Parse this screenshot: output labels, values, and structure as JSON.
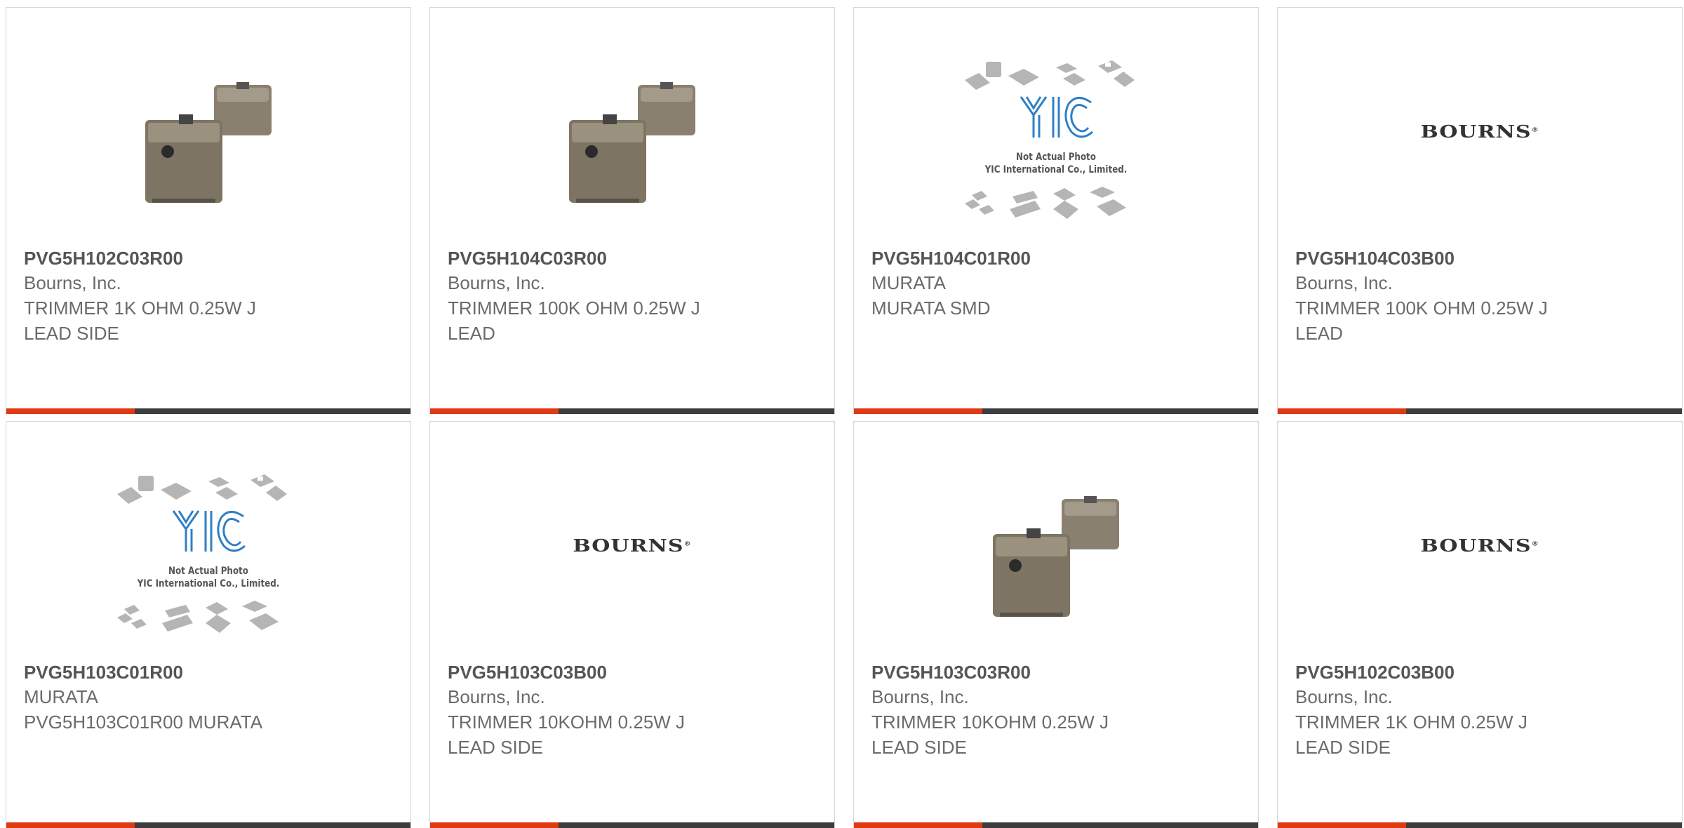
{
  "products": [
    {
      "part_number": "PVG5H102C03R00",
      "manufacturer": "Bourns, Inc.",
      "desc_line1": "TRIMMER 1K OHM 0.25W J",
      "desc_line2": "LEAD SIDE",
      "image": "trimmer-photo"
    },
    {
      "part_number": "PVG5H104C03R00",
      "manufacturer": "Bourns, Inc.",
      "desc_line1": "TRIMMER 100K OHM 0.25W J",
      "desc_line2": "LEAD",
      "image": "trimmer-photo"
    },
    {
      "part_number": "PVG5H104C01R00",
      "manufacturer": "MURATA",
      "desc_line1": "MURATA SMD",
      "desc_line2": "",
      "image": "yic-placeholder",
      "placeholder_line1": "Not Actual Photo",
      "placeholder_line2": "YIC International Co., Limited."
    },
    {
      "part_number": "PVG5H104C03B00",
      "manufacturer": "Bourns, Inc.",
      "desc_line1": "TRIMMER 100K OHM 0.25W J",
      "desc_line2": "LEAD",
      "image": "bourns-logo",
      "logo_text": "BOURNS"
    },
    {
      "part_number": "PVG5H103C01R00",
      "manufacturer": "MURATA",
      "desc_line1": "PVG5H103C01R00 MURATA",
      "desc_line2": "",
      "image": "yic-placeholder",
      "placeholder_line1": "Not Actual Photo",
      "placeholder_line2": "YIC International Co., Limited."
    },
    {
      "part_number": "PVG5H103C03B00",
      "manufacturer": "Bourns, Inc.",
      "desc_line1": "TRIMMER 10KOHM 0.25W J",
      "desc_line2": "LEAD SIDE",
      "image": "bourns-logo",
      "logo_text": "BOURNS"
    },
    {
      "part_number": "PVG5H103C03R00",
      "manufacturer": "Bourns, Inc.",
      "desc_line1": "TRIMMER 10KOHM 0.25W J",
      "desc_line2": "LEAD SIDE",
      "image": "trimmer-photo"
    },
    {
      "part_number": "PVG5H102C03B00",
      "manufacturer": "Bourns, Inc.",
      "desc_line1": "TRIMMER 1K OHM 0.25W J",
      "desc_line2": "LEAD SIDE",
      "image": "bourns-logo",
      "logo_text": "BOURNS"
    }
  ],
  "colors": {
    "accent_bar": "#e03a12",
    "dark_bar": "#3d3d3d",
    "yic_blue": "#2f7fc6"
  }
}
